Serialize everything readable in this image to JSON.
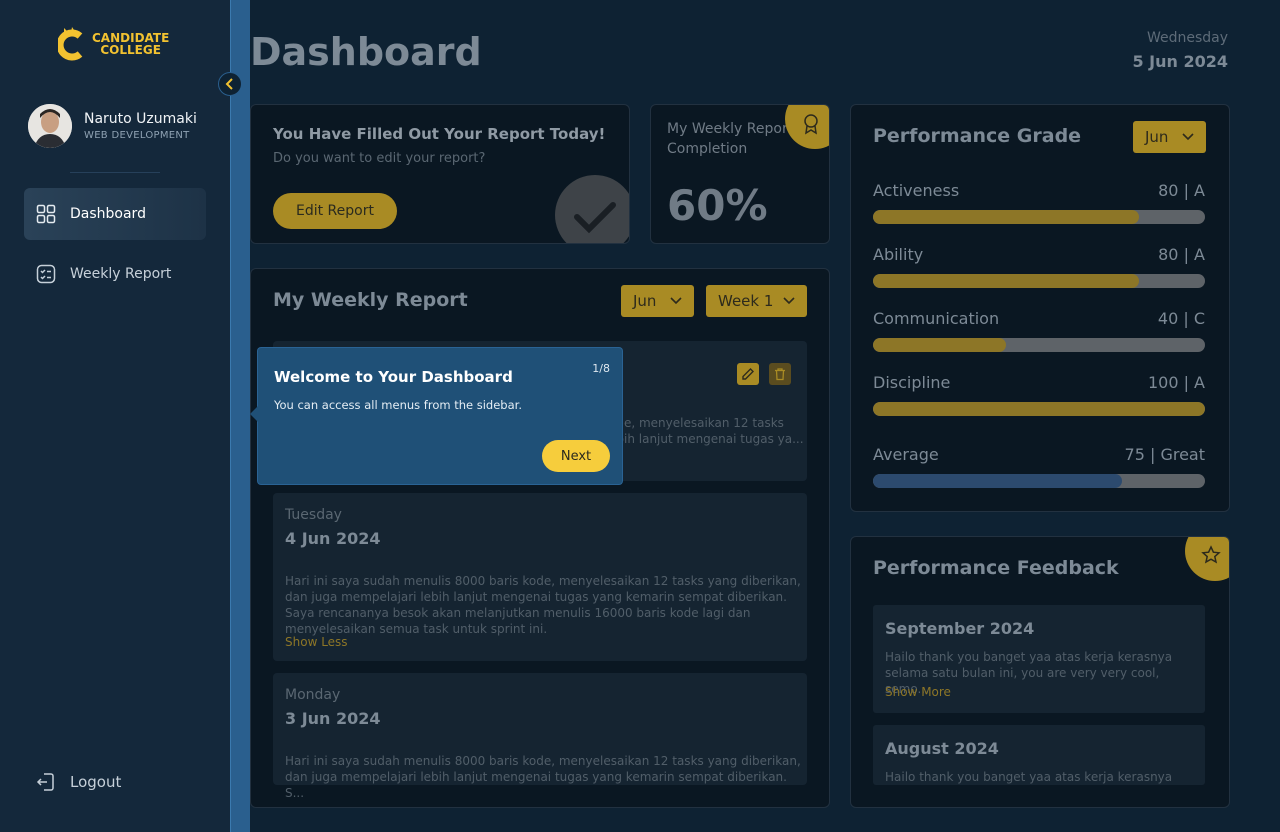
{
  "brand": {
    "line1": "CANDIDATE",
    "line2": "COLLEGE",
    "color": "#f2c230"
  },
  "user": {
    "name": "Naruto Uzumaki",
    "role": "WEB DEVELOPMENT"
  },
  "sidebar": {
    "items": [
      {
        "label": "Dashboard",
        "icon": "grid-icon",
        "active": true
      },
      {
        "label": "Weekly Report",
        "icon": "checklist-icon",
        "active": false
      }
    ],
    "logout_label": "Logout"
  },
  "header": {
    "title": "Dashboard",
    "day": "Wednesday",
    "date": "5 Jun 2024"
  },
  "filled_card": {
    "title": "You Have Filled Out Your Report Today!",
    "subtitle": "Do you want to edit your report?",
    "button": "Edit Report"
  },
  "completion_card": {
    "label_line1": "My Weekly Report",
    "label_line2": "Completion",
    "value": "60%",
    "progress": 0.6
  },
  "weekly_report": {
    "title": "My Weekly Report",
    "month": "Jun",
    "week": "Week 1",
    "partial_line1": "ode, menyelesaikan 12 tasks",
    "partial_line2": "ebih lanjut mengenai tugas ya...",
    "items": [
      {
        "day": "Tuesday",
        "date": "4 Jun 2024",
        "text": "Hari ini saya sudah menulis 8000 baris kode, menyelesaikan 12 tasks yang diberikan, dan juga mempelajari lebih lanjut mengenai tugas yang kemarin sempat diberikan. Saya rencananya besok akan melanjutkan menulis 16000 baris kode lagi dan menyelesaikan semua task untuk sprint ini.",
        "link": "Show Less"
      },
      {
        "day": "Monday",
        "date": "3 Jun 2024",
        "text": "Hari ini saya sudah menulis 8000 baris kode, menyelesaikan 12 tasks yang diberikan, dan juga mempelajari lebih lanjut mengenai tugas yang kemarin sempat diberikan. S..."
      }
    ]
  },
  "performance": {
    "title": "Performance Grade",
    "month": "Jun",
    "metrics": [
      {
        "name": "Activeness",
        "score": "80 | A",
        "value": 80
      },
      {
        "name": "Ability",
        "score": "80 | A",
        "value": 80
      },
      {
        "name": "Communication",
        "score": "40 | C",
        "value": 40
      },
      {
        "name": "Discipline",
        "score": "100 | A",
        "value": 100
      }
    ],
    "average": {
      "name": "Average",
      "score": "75 | Great",
      "value": 75
    }
  },
  "feedback": {
    "title": "Performance Feedback",
    "items": [
      {
        "month": "September 2024",
        "text": "Hailo thank you banget yaa atas kerja kerasnya selama satu bulan ini, you are very very cool, semo...",
        "link": "Show More"
      },
      {
        "month": "August 2024",
        "text": "Hailo thank you banget yaa atas kerja kerasnya"
      }
    ]
  },
  "tooltip": {
    "title": "Welcome to Your Dashboard",
    "body": "You can access all menus from the sidebar.",
    "step": "1/8",
    "next": "Next"
  }
}
